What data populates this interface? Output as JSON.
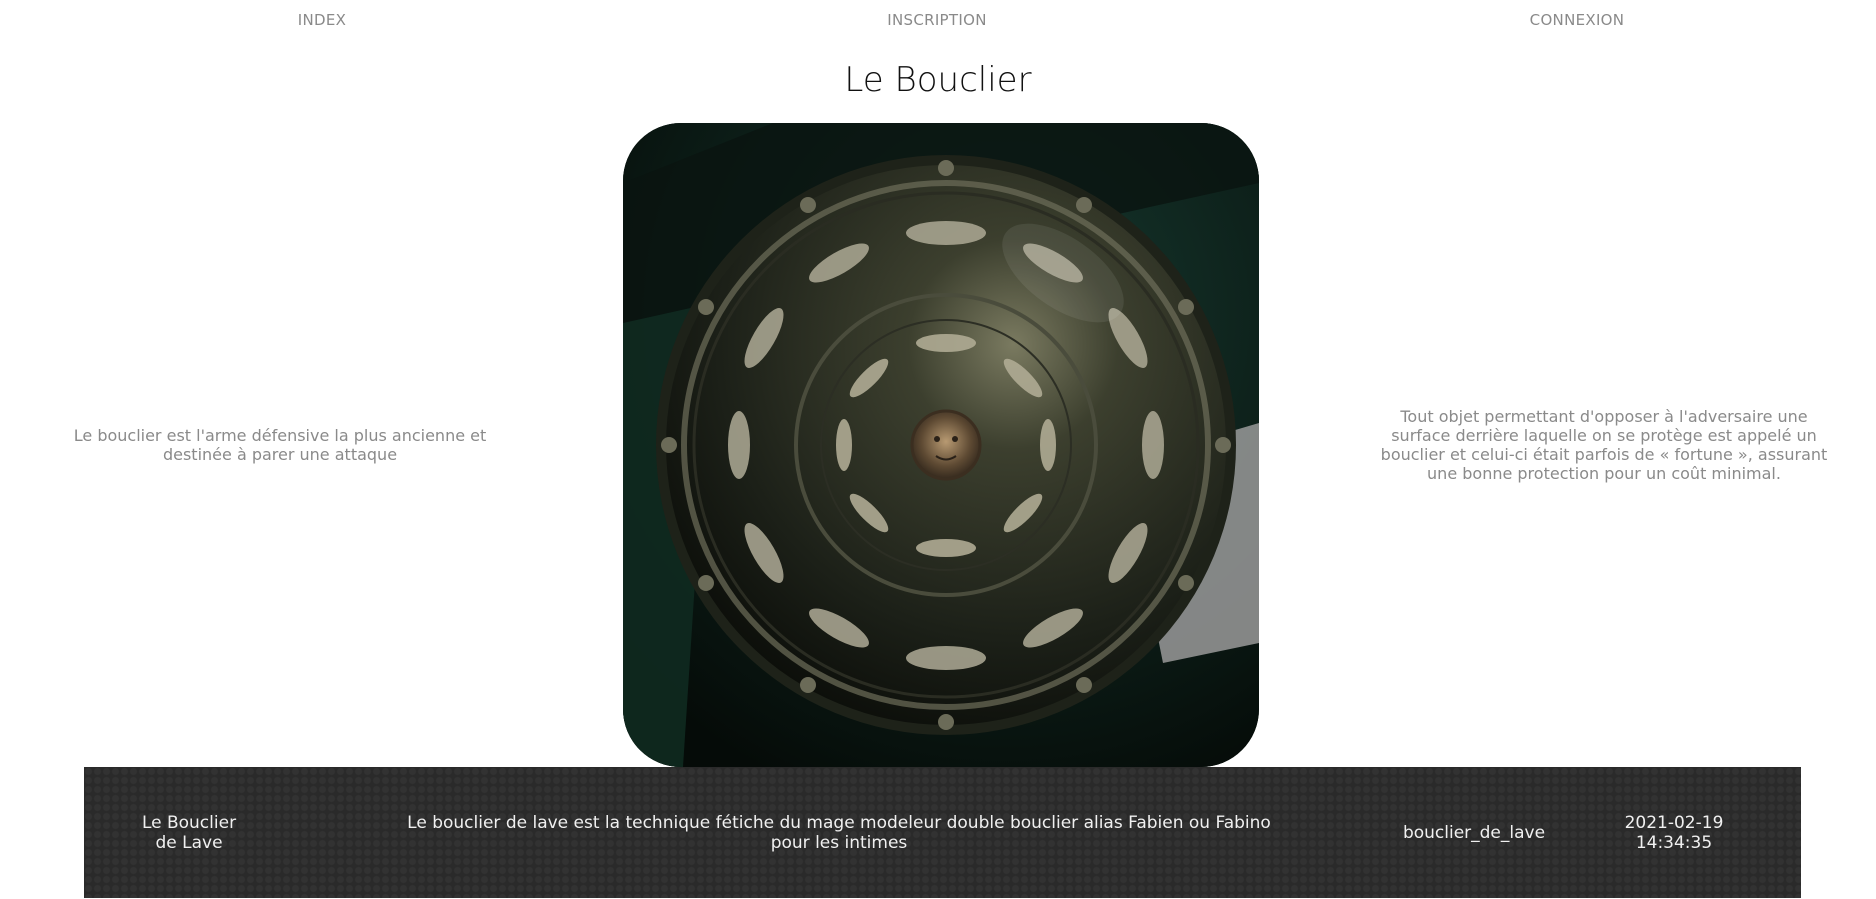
{
  "nav": {
    "index": "INDEX",
    "inscription": "INSCRIPTION",
    "connexion": "CONNEXION"
  },
  "page": {
    "title": "Le Bouclier"
  },
  "hero": {
    "image_alt": "Bouclier rond en bronze orné de couronnes de laurier et d'une tête de Méduse au centre"
  },
  "left_text": "Le bouclier est l'arme défensive la plus ancienne et destinée à parer une attaque",
  "right_text": "Tout objet permettant d'opposer à l'adversaire une surface derrière laquelle on se protège est appelé un bouclier et celui-ci était parfois de « fortune », assurant une bonne protection pour un coût minimal.",
  "footer": {
    "name": "Le Bouclier de Lave",
    "description": "Le bouclier de lave est la technique fétiche du mage modeleur double bouclier alias Fabien ou Fabino pour les intimes",
    "slug": "bouclier_de_lave",
    "date": "2021-02-19 14:34:35"
  },
  "colors": {
    "footer_bg": "#2a2a2a",
    "nav_text": "#8a8a8a",
    "title_text": "#111111"
  }
}
